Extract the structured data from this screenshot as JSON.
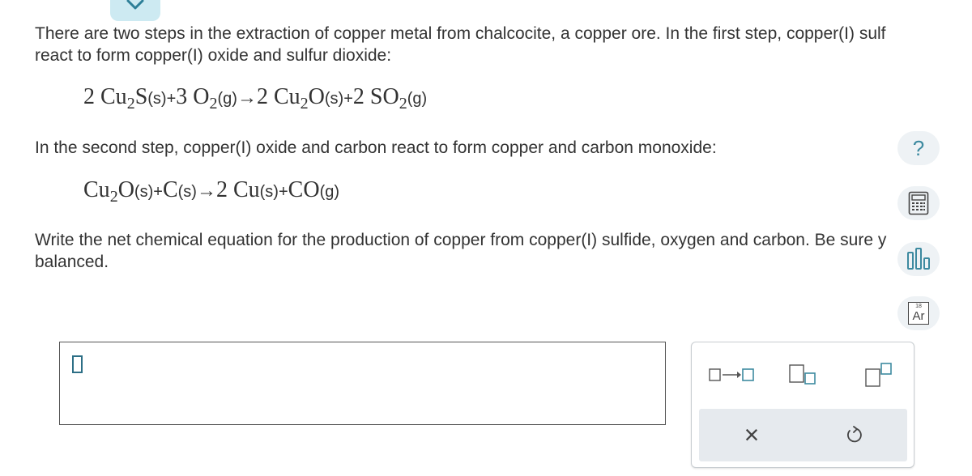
{
  "intro": {
    "line1": "There are two steps in the extraction of copper metal from chalcocite, a copper ore. In the first step, copper(I) sulf",
    "line2": "react to form copper(I) oxide and sulfur dioxide:"
  },
  "equation1": {
    "c1": "2",
    "f1a": "Cu",
    "f1s": "2",
    "f1b": "S",
    "st1": "(s)",
    "plus1": "+",
    "c2": "3",
    "f2a": "O",
    "f2s": "2",
    "st2": "(g)",
    "arrow": "→",
    "c3": "2",
    "f3a": "Cu",
    "f3s": "2",
    "f3b": "O",
    "st3": "(s)",
    "plus2": "+",
    "c4": "2",
    "f4a": "SO",
    "f4s": "2",
    "st4": "(g)"
  },
  "second_step": {
    "text": "In the second step, copper(I) oxide and carbon react to form copper and carbon monoxide:"
  },
  "equation2": {
    "f1a": "Cu",
    "f1s": "2",
    "f1b": "O",
    "st1": "(s)",
    "plus1": "+",
    "f2": "C",
    "st2": "(s)",
    "arrow": "→",
    "c3": "2",
    "f3": "Cu",
    "st3": "(s)",
    "plus2": "+",
    "f4": "CO",
    "st4": "(g)"
  },
  "question": {
    "line1": "Write the net chemical equation for the production of copper from copper(I) sulfide, oxygen and carbon. Be sure y",
    "line2": "balanced."
  },
  "tools": {
    "help_label": "?",
    "periodic_number": "18",
    "periodic_symbol": "Ar"
  },
  "palette": {
    "clear_label": "×"
  },
  "colors": {
    "accent": "#3d8aa0",
    "tool_bg": "#eef2f5",
    "tab_bg": "#cdeaf2",
    "palette_bar": "#e6eaee"
  },
  "icons": {
    "collapse": "chevron-down-icon",
    "help": "question-icon",
    "calculator": "calculator-icon",
    "data": "bar-chart-icon",
    "periodic": "periodic-table-icon",
    "arrow_template": "reaction-arrow-icon",
    "subscript": "subscript-icon",
    "superscript": "superscript-icon",
    "clear": "close-icon",
    "undo": "undo-icon"
  }
}
